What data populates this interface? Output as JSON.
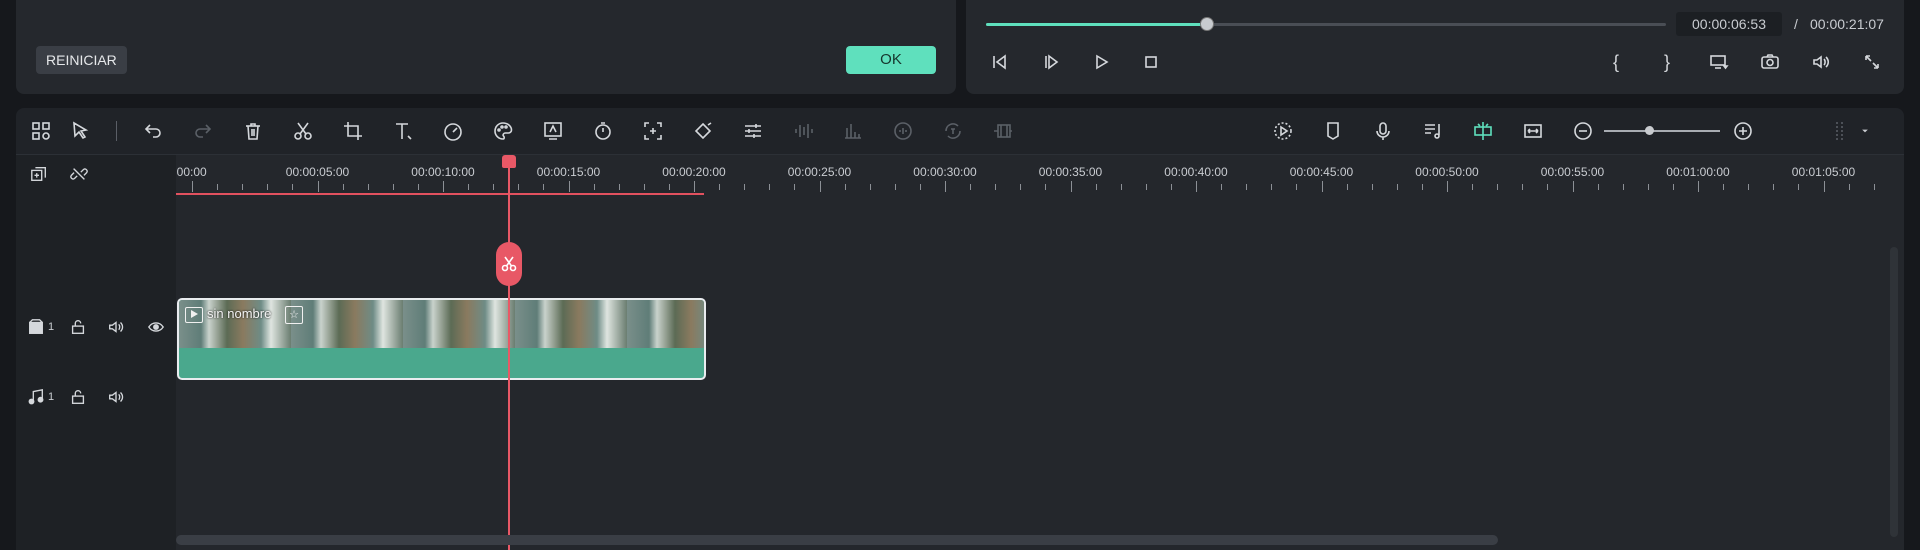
{
  "effect_panel": {
    "reset_label": "REINICIAR",
    "ok_label": "OK"
  },
  "player": {
    "current_time": "00:00:06:53",
    "separator": "/",
    "total_time": "00:00:21:07",
    "progress_fraction": 0.325,
    "mark_in_label": "{",
    "mark_out_label": "}"
  },
  "toolbar": {
    "zoom_fraction": 0.4
  },
  "ruler": {
    "labels": [
      ":00:00",
      "00:00:05:00",
      "00:00:10:00",
      "00:00:15:00",
      "00:00:20:00",
      "00:00:25:00",
      "00:00:30:00",
      "00:00:35:00",
      "00:00:40:00",
      "00:00:45:00",
      "00:00:50:00",
      "00:00:55:00",
      "00:01:00:00",
      "00:01:05:00"
    ]
  },
  "tracks": {
    "video_track_number": "1",
    "audio_track_number": "1"
  },
  "clip": {
    "title": "sin nombre",
    "fx_badge": "☆"
  },
  "colors": {
    "accent": "#5fe0bd",
    "playhead": "#e85866",
    "clip": "#4aa88d"
  }
}
